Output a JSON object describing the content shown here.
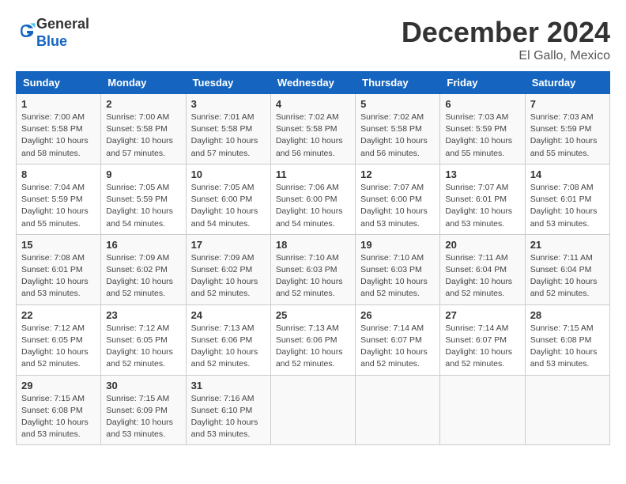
{
  "logo": {
    "line1": "General",
    "line2": "Blue"
  },
  "title": "December 2024",
  "subtitle": "El Gallo, Mexico",
  "days_of_week": [
    "Sunday",
    "Monday",
    "Tuesday",
    "Wednesday",
    "Thursday",
    "Friday",
    "Saturday"
  ],
  "weeks": [
    [
      {
        "day": "1",
        "info": "Sunrise: 7:00 AM\nSunset: 5:58 PM\nDaylight: 10 hours\nand 58 minutes."
      },
      {
        "day": "2",
        "info": "Sunrise: 7:00 AM\nSunset: 5:58 PM\nDaylight: 10 hours\nand 57 minutes."
      },
      {
        "day": "3",
        "info": "Sunrise: 7:01 AM\nSunset: 5:58 PM\nDaylight: 10 hours\nand 57 minutes."
      },
      {
        "day": "4",
        "info": "Sunrise: 7:02 AM\nSunset: 5:58 PM\nDaylight: 10 hours\nand 56 minutes."
      },
      {
        "day": "5",
        "info": "Sunrise: 7:02 AM\nSunset: 5:58 PM\nDaylight: 10 hours\nand 56 minutes."
      },
      {
        "day": "6",
        "info": "Sunrise: 7:03 AM\nSunset: 5:59 PM\nDaylight: 10 hours\nand 55 minutes."
      },
      {
        "day": "7",
        "info": "Sunrise: 7:03 AM\nSunset: 5:59 PM\nDaylight: 10 hours\nand 55 minutes."
      }
    ],
    [
      {
        "day": "8",
        "info": "Sunrise: 7:04 AM\nSunset: 5:59 PM\nDaylight: 10 hours\nand 55 minutes."
      },
      {
        "day": "9",
        "info": "Sunrise: 7:05 AM\nSunset: 5:59 PM\nDaylight: 10 hours\nand 54 minutes."
      },
      {
        "day": "10",
        "info": "Sunrise: 7:05 AM\nSunset: 6:00 PM\nDaylight: 10 hours\nand 54 minutes."
      },
      {
        "day": "11",
        "info": "Sunrise: 7:06 AM\nSunset: 6:00 PM\nDaylight: 10 hours\nand 54 minutes."
      },
      {
        "day": "12",
        "info": "Sunrise: 7:07 AM\nSunset: 6:00 PM\nDaylight: 10 hours\nand 53 minutes."
      },
      {
        "day": "13",
        "info": "Sunrise: 7:07 AM\nSunset: 6:01 PM\nDaylight: 10 hours\nand 53 minutes."
      },
      {
        "day": "14",
        "info": "Sunrise: 7:08 AM\nSunset: 6:01 PM\nDaylight: 10 hours\nand 53 minutes."
      }
    ],
    [
      {
        "day": "15",
        "info": "Sunrise: 7:08 AM\nSunset: 6:01 PM\nDaylight: 10 hours\nand 53 minutes."
      },
      {
        "day": "16",
        "info": "Sunrise: 7:09 AM\nSunset: 6:02 PM\nDaylight: 10 hours\nand 52 minutes."
      },
      {
        "day": "17",
        "info": "Sunrise: 7:09 AM\nSunset: 6:02 PM\nDaylight: 10 hours\nand 52 minutes."
      },
      {
        "day": "18",
        "info": "Sunrise: 7:10 AM\nSunset: 6:03 PM\nDaylight: 10 hours\nand 52 minutes."
      },
      {
        "day": "19",
        "info": "Sunrise: 7:10 AM\nSunset: 6:03 PM\nDaylight: 10 hours\nand 52 minutes."
      },
      {
        "day": "20",
        "info": "Sunrise: 7:11 AM\nSunset: 6:04 PM\nDaylight: 10 hours\nand 52 minutes."
      },
      {
        "day": "21",
        "info": "Sunrise: 7:11 AM\nSunset: 6:04 PM\nDaylight: 10 hours\nand 52 minutes."
      }
    ],
    [
      {
        "day": "22",
        "info": "Sunrise: 7:12 AM\nSunset: 6:05 PM\nDaylight: 10 hours\nand 52 minutes."
      },
      {
        "day": "23",
        "info": "Sunrise: 7:12 AM\nSunset: 6:05 PM\nDaylight: 10 hours\nand 52 minutes."
      },
      {
        "day": "24",
        "info": "Sunrise: 7:13 AM\nSunset: 6:06 PM\nDaylight: 10 hours\nand 52 minutes."
      },
      {
        "day": "25",
        "info": "Sunrise: 7:13 AM\nSunset: 6:06 PM\nDaylight: 10 hours\nand 52 minutes."
      },
      {
        "day": "26",
        "info": "Sunrise: 7:14 AM\nSunset: 6:07 PM\nDaylight: 10 hours\nand 52 minutes."
      },
      {
        "day": "27",
        "info": "Sunrise: 7:14 AM\nSunset: 6:07 PM\nDaylight: 10 hours\nand 52 minutes."
      },
      {
        "day": "28",
        "info": "Sunrise: 7:15 AM\nSunset: 6:08 PM\nDaylight: 10 hours\nand 53 minutes."
      }
    ],
    [
      {
        "day": "29",
        "info": "Sunrise: 7:15 AM\nSunset: 6:08 PM\nDaylight: 10 hours\nand 53 minutes."
      },
      {
        "day": "30",
        "info": "Sunrise: 7:15 AM\nSunset: 6:09 PM\nDaylight: 10 hours\nand 53 minutes."
      },
      {
        "day": "31",
        "info": "Sunrise: 7:16 AM\nSunset: 6:10 PM\nDaylight: 10 hours\nand 53 minutes."
      },
      {
        "day": "",
        "info": ""
      },
      {
        "day": "",
        "info": ""
      },
      {
        "day": "",
        "info": ""
      },
      {
        "day": "",
        "info": ""
      }
    ]
  ]
}
